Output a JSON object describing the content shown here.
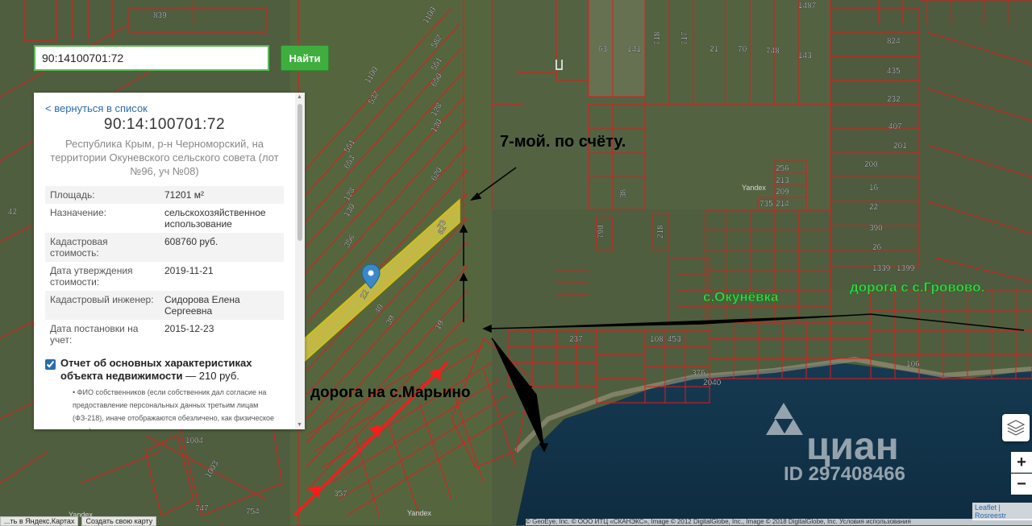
{
  "search": {
    "value": "90:14100701:72",
    "button_label": "Найти"
  },
  "panel": {
    "back_link": "< вернуться в список",
    "title": "90:14:100701:72",
    "address": "Республика Крым, р-н Черноморский, на территории Окуневского сельского совета (лот №96, уч №08)",
    "rows": [
      {
        "key": "Площадь:",
        "value": "71201 м²"
      },
      {
        "key": "Назначение:",
        "value": "сельскохозяйственное использование"
      },
      {
        "key": "Кадастровая стоимость:",
        "value": "608760 руб."
      },
      {
        "key": "Дата утверждения стоимости:",
        "value": "2019-11-21"
      },
      {
        "key": "Кадастровый инженер:",
        "value": "Сидорова Елена Сергеевна"
      },
      {
        "key": "Дата постановки на учет:",
        "value": "2015-12-23"
      }
    ],
    "report_title": "Отчет об основных характеристиках объекта недвижимости",
    "report_price": " — 210 руб.",
    "report_desc": "• ФИО собственников (если собственник дал согласие на предоставление персональных данных третьим лицам (ФЗ-218), иначе отображаются обезличено, как физическое лицо)"
  },
  "annotations": {
    "seventh": "7-мой. по счёту.",
    "village": "с.Окунёвка",
    "road_grovovo": "дорога с с.Грово­во.",
    "road_marino": "дорога на с.Марьино"
  },
  "watermark": {
    "brand": "циан",
    "id": "ID 297408466"
  },
  "map_labels": {
    "yandex": "Yandex",
    "parcel_numbers": [
      "839",
      "1100",
      "582",
      "551",
      "650",
      "1100",
      "532",
      "128",
      "130",
      "551",
      "653",
      "128",
      "130",
      "356",
      "620",
      "62",
      "63",
      "141",
      "718",
      "717",
      "21",
      "70",
      "748",
      "143",
      "1487",
      "824",
      "435",
      "232",
      "407",
      "201",
      "200",
      "16",
      "22",
      "390",
      "26",
      "1339",
      "1399",
      "256",
      "213",
      "209",
      "214",
      "735",
      "38",
      "790",
      "218",
      "237",
      "108",
      "453",
      "376",
      "2040",
      "106",
      "42",
      "1004",
      "1003",
      "747",
      "754",
      "357",
      "19",
      "39",
      "40",
      "73",
      "22"
    ]
  },
  "controls": {
    "zoom_in": "+",
    "zoom_out": "−",
    "leaflet": "Leaflet | Rosreestr"
  },
  "bottom_links": [
    "...ть в Яндекс.Картах",
    "Создать свою карту"
  ],
  "attribution": "© GeoEye, Inc. © ООО ИТЦ «СКАНЭКС», Image © 2012 DigitalGlobe, Inc., Image © 2018 DigitalGlobe, Inc. Условия использования"
}
